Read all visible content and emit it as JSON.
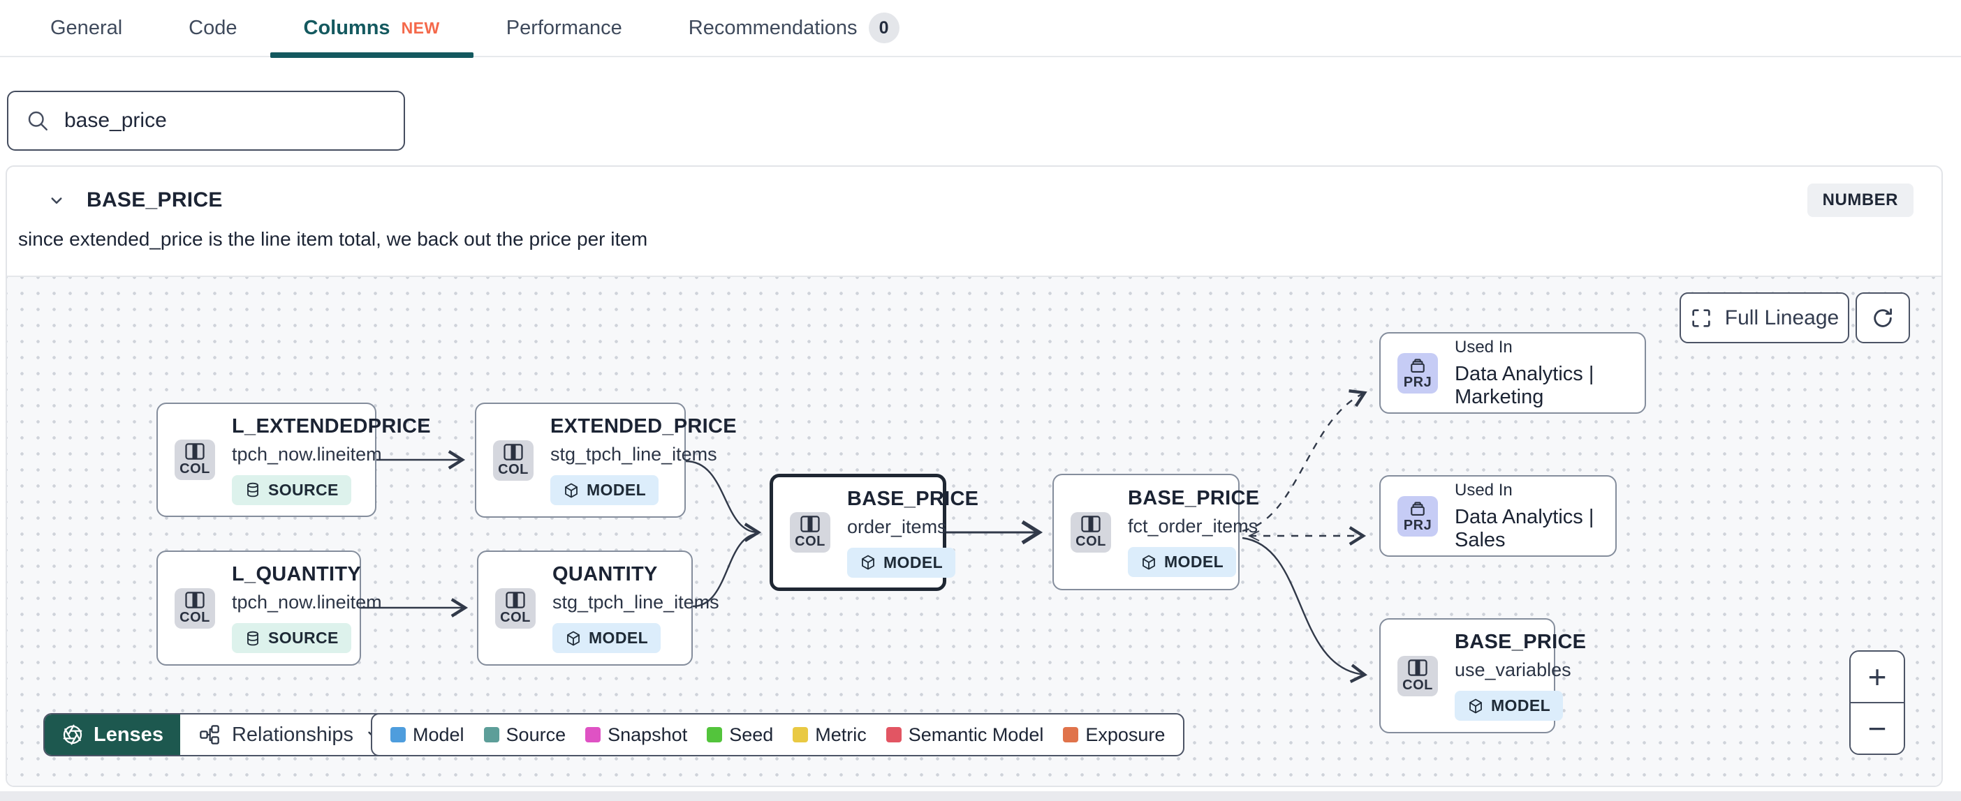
{
  "tabs": {
    "items": [
      {
        "label": "General"
      },
      {
        "label": "Code"
      },
      {
        "label": "Columns",
        "badge": "NEW",
        "active": true
      },
      {
        "label": "Performance"
      },
      {
        "label": "Recommendations",
        "count": "0"
      }
    ],
    "active_color": "#14595f",
    "new_badge_color": "#f4694b"
  },
  "search": {
    "value": "base_price"
  },
  "column": {
    "name": "BASE_PRICE",
    "type": "NUMBER",
    "description": "since extended_price is the line item total, we back out the price per item"
  },
  "lineage": {
    "full_lineage_label": "Full Lineage",
    "lenses_label": "Lenses",
    "lenses_color": "#1d584f",
    "relationships_label": "Relationships",
    "zoom_in": "+",
    "zoom_out": "−",
    "nodes": [
      {
        "kind": "COL",
        "title": "L_EXTENDEDPRICE",
        "subtitle": "tpch_now.lineitem",
        "badge": "SOURCE",
        "icon": "columns-icon",
        "badge_icon": "database-icon"
      },
      {
        "kind": "COL",
        "title": "EXTENDED_PRICE",
        "subtitle": "stg_tpch_line_items",
        "badge": "MODEL",
        "icon": "columns-icon",
        "badge_icon": "cube-icon"
      },
      {
        "kind": "COL",
        "title": "L_QUANTITY",
        "subtitle": "tpch_now.lineitem",
        "badge": "SOURCE",
        "icon": "columns-icon",
        "badge_icon": "database-icon"
      },
      {
        "kind": "COL",
        "title": "QUANTITY",
        "subtitle": "stg_tpch_line_items",
        "badge": "MODEL",
        "icon": "columns-icon",
        "badge_icon": "cube-icon"
      },
      {
        "kind": "COL",
        "title": "BASE_PRICE",
        "subtitle": "order_items",
        "badge": "MODEL",
        "selected": true,
        "icon": "columns-icon",
        "badge_icon": "cube-icon"
      },
      {
        "kind": "COL",
        "title": "BASE_PRICE",
        "subtitle": "fct_order_items",
        "badge": "MODEL",
        "icon": "columns-icon",
        "badge_icon": "cube-icon"
      },
      {
        "kind": "PRJ",
        "label": "Used In",
        "title": "Data Analytics | Marketing",
        "icon": "archive-icon"
      },
      {
        "kind": "PRJ",
        "label": "Used In",
        "title": "Data Analytics | Sales",
        "icon": "archive-icon"
      },
      {
        "kind": "COL",
        "title": "BASE_PRICE",
        "subtitle": "use_variables",
        "badge": "MODEL",
        "icon": "columns-icon",
        "badge_icon": "cube-icon"
      }
    ],
    "legend": [
      {
        "label": "Model",
        "color": "#4e9ddd"
      },
      {
        "label": "Source",
        "color": "#5d9e99"
      },
      {
        "label": "Snapshot",
        "color": "#df52c4"
      },
      {
        "label": "Seed",
        "color": "#53c43c"
      },
      {
        "label": "Metric",
        "color": "#e9c943"
      },
      {
        "label": "Semantic Model",
        "color": "#e25563"
      },
      {
        "label": "Exposure",
        "color": "#e0734b"
      }
    ]
  }
}
